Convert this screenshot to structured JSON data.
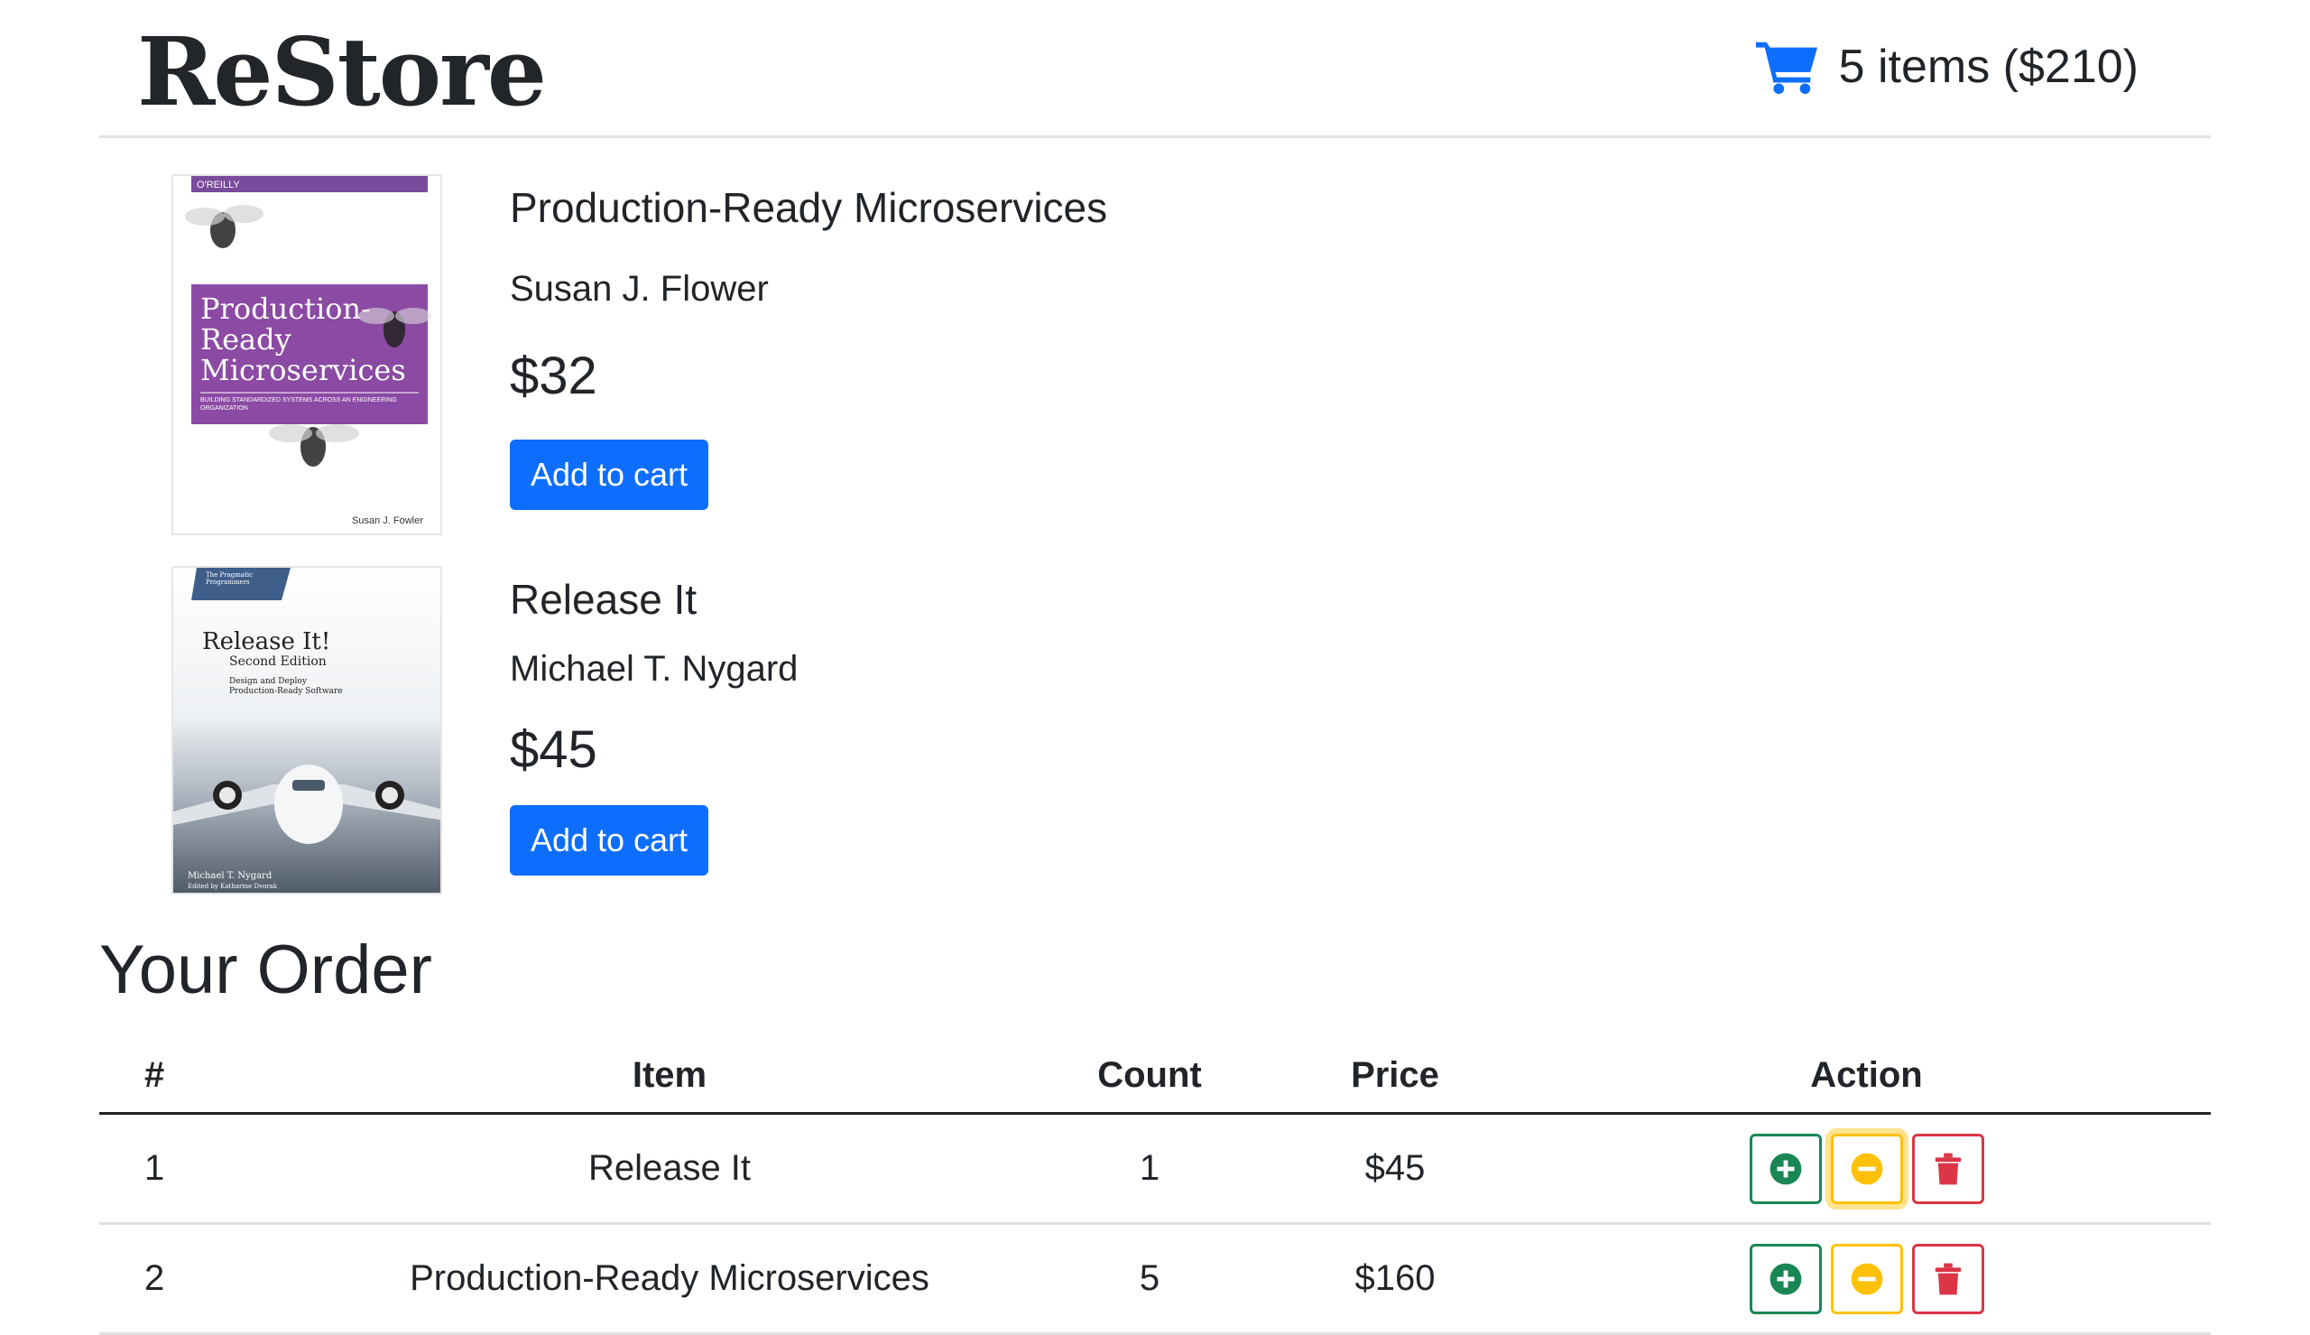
{
  "header": {
    "brand": "ReStore",
    "cart_icon": "shopping-cart-icon",
    "cart_summary": "5 items ($210)"
  },
  "colors": {
    "primary": "#0d6efd",
    "success": "#198754",
    "warning": "#ffc107",
    "danger": "#dc3545"
  },
  "products": [
    {
      "title": "Production-Ready Microservices",
      "author": "Susan J. Flower",
      "price": "$32",
      "button": "Add to cart",
      "cover": {
        "publisher": "O'REILLY",
        "title_lines": [
          "Production-",
          "Ready",
          "Microservices"
        ],
        "subtitle": "BUILDING STANDARDIZED SYSTEMS ACROSS AN ENGINEERING ORGANIZATION",
        "author": "Susan J. Fowler"
      }
    },
    {
      "title": "Release It",
      "author": "Michael T. Nygard",
      "price": "$45",
      "button": "Add to cart",
      "cover": {
        "publisher": "The Pragmatic Programmers",
        "title": "Release It!",
        "edition": "Second Edition",
        "tagline_1": "Design and Deploy",
        "tagline_2": "Production-Ready Software",
        "author": "Michael T. Nygard",
        "editor": "Edited by Katharine Dvorak"
      }
    }
  ],
  "order": {
    "title": "Your Order",
    "columns": [
      "#",
      "Item",
      "Count",
      "Price",
      "Action"
    ],
    "rows": [
      {
        "num": "1",
        "item": "Release It",
        "count": "1",
        "price": "$45"
      },
      {
        "num": "2",
        "item": "Production-Ready Microservices",
        "count": "5",
        "price": "$160"
      }
    ]
  }
}
